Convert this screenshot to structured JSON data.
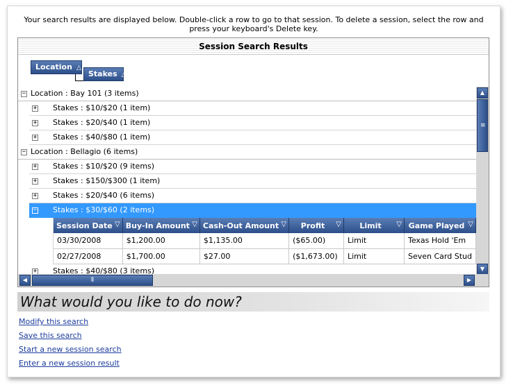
{
  "intro": "Your search results are displayed below. Double-click a row to go to that session. To delete a session, select the row and press your keyboard's Delete key.",
  "grid": {
    "caption": "Session Search Results",
    "group_by": [
      "Location",
      "Stakes"
    ],
    "rows": [
      {
        "level": 0,
        "expander": "−",
        "text": "Location : Bay 101 (3 items)"
      },
      {
        "level": 1,
        "expander": "+",
        "text": "Stakes : $10/$20 (1 item)"
      },
      {
        "level": 1,
        "expander": "+",
        "text": "Stakes : $20/$40 (1 item)"
      },
      {
        "level": 1,
        "expander": "+",
        "text": "Stakes : $40/$80 (1 item)"
      },
      {
        "level": 0,
        "expander": "−",
        "text": "Location : Bellagio (6 items)"
      },
      {
        "level": 1,
        "expander": "+",
        "text": "Stakes : $10/$20 (9 items)"
      },
      {
        "level": 1,
        "expander": "+",
        "text": "Stakes : $150/$300 (1 item)"
      },
      {
        "level": 1,
        "expander": "+",
        "text": "Stakes : $20/$40 (6 items)"
      },
      {
        "level": 1,
        "expander": "−",
        "text": "Stakes : $30/$60 (2 items)",
        "selected": true
      }
    ],
    "detail": {
      "columns": [
        "Session Date",
        "Buy-In Amount",
        "Cash-Out Amount",
        "Profit",
        "Limit",
        "Game Played"
      ],
      "rows": [
        [
          "03/30/2008",
          "$1,200.00",
          "$1,135.00",
          "($65.00)",
          "Limit",
          "Texas Hold 'Em"
        ],
        [
          "02/27/2008",
          "$1,700.00",
          "$27.00",
          "($1,673.00)",
          "Limit",
          "Seven Card Stud"
        ]
      ]
    },
    "after_rows": [
      {
        "level": 1,
        "expander": "+",
        "text": "Stakes : $40/$80 (3 items)"
      }
    ]
  },
  "next": {
    "heading": "What would you like to do now?",
    "links": [
      "Modify this search",
      "Save this search",
      "Start a new session search",
      "Enter a new session result"
    ]
  }
}
